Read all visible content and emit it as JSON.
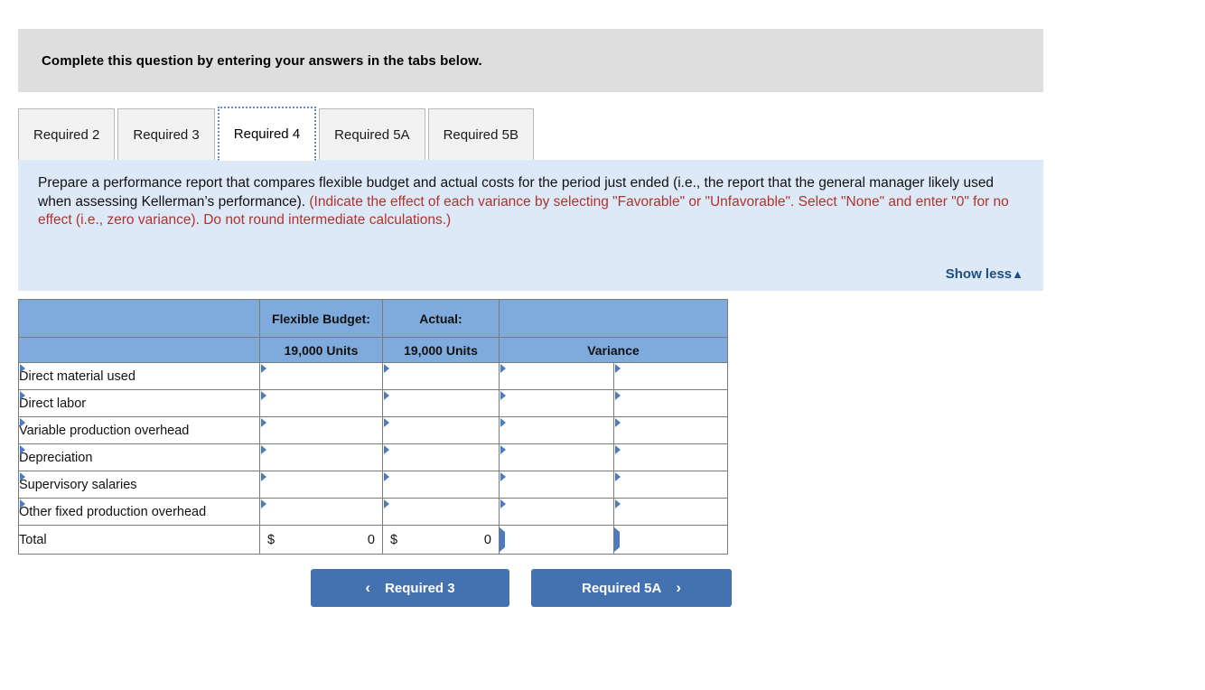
{
  "banner": {
    "text": "Complete this question by entering your answers in the tabs below."
  },
  "tabs": [
    {
      "label": "Required 2",
      "active": false
    },
    {
      "label": "Required 3",
      "active": false
    },
    {
      "label": "Required 4",
      "active": true
    },
    {
      "label": "Required 5A",
      "active": false
    },
    {
      "label": "Required 5B",
      "active": false
    }
  ],
  "instructions": {
    "black_part": "Prepare a performance report that compares flexible budget and actual costs for the period just ended (i.e., the report that the general manager likely used when assessing Kellerman’s performance). ",
    "red_part": "(Indicate the effect of each variance by selecting \"Favorable\" or \"Unfavorable\". Select \"None\" and enter \"0\" for no effect (i.e., zero variance). Do not round intermediate calculations.)",
    "show_less_label": "Show less",
    "show_less_caret": "▲"
  },
  "table": {
    "header_row1": {
      "blank": "",
      "flexible_budget": "Flexible Budget:",
      "actual": "Actual:",
      "blank2": ""
    },
    "header_row2": {
      "blank": "",
      "flexible_budget_units": "19,000 Units",
      "actual_units": "19,000 Units",
      "variance": "Variance"
    },
    "rows": [
      {
        "label": "Direct material used",
        "flexible_budget": "",
        "actual": "",
        "variance_amount": "",
        "variance_effect": ""
      },
      {
        "label": "Direct labor",
        "flexible_budget": "",
        "actual": "",
        "variance_amount": "",
        "variance_effect": ""
      },
      {
        "label": "Variable production overhead",
        "flexible_budget": "",
        "actual": "",
        "variance_amount": "",
        "variance_effect": ""
      },
      {
        "label": "Depreciation",
        "flexible_budget": "",
        "actual": "",
        "variance_amount": "",
        "variance_effect": ""
      },
      {
        "label": "Supervisory salaries",
        "flexible_budget": "",
        "actual": "",
        "variance_amount": "",
        "variance_effect": ""
      },
      {
        "label": "Other fixed production overhead",
        "flexible_budget": "",
        "actual": "",
        "variance_amount": "",
        "variance_effect": ""
      }
    ],
    "total": {
      "label": "Total",
      "flexible_budget_currency": "$",
      "flexible_budget_value": "0",
      "actual_currency": "$",
      "actual_value": "0",
      "variance_amount": "",
      "variance_effect": ""
    }
  },
  "navigation": {
    "prev_label": "Required 3",
    "prev_chevron": "‹",
    "next_label": "Required 5A",
    "next_chevron": "›"
  },
  "colors": {
    "banner_gray": "#dedede",
    "instruction_blue": "#dee9f7",
    "table_header_blue": "#7faadc",
    "button_blue": "#4472b0",
    "red_text": "#b0332c",
    "link_navy": "#1f4e82",
    "cell_border_blue": "#6f9bd1"
  }
}
